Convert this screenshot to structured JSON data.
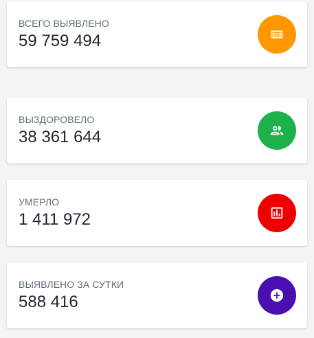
{
  "stats": [
    {
      "label": "ВСЕГО ВЫЯВЛЕНО",
      "value": "59 759 494",
      "icon": "counter-icon",
      "color": "#ff9800"
    },
    {
      "label": "ВЫЗДОРОВЕЛО",
      "value": "38 361 644",
      "icon": "people-icon",
      "color": "#1eb04a"
    },
    {
      "label": "УМЕРЛО",
      "value": "1 411 972",
      "icon": "chart-icon",
      "color": "#ee0000"
    },
    {
      "label": "ВЫЯВЛЕНО ЗА СУТКИ",
      "value": "588 416",
      "icon": "add-circle-icon",
      "color": "#4a0fb0"
    }
  ]
}
